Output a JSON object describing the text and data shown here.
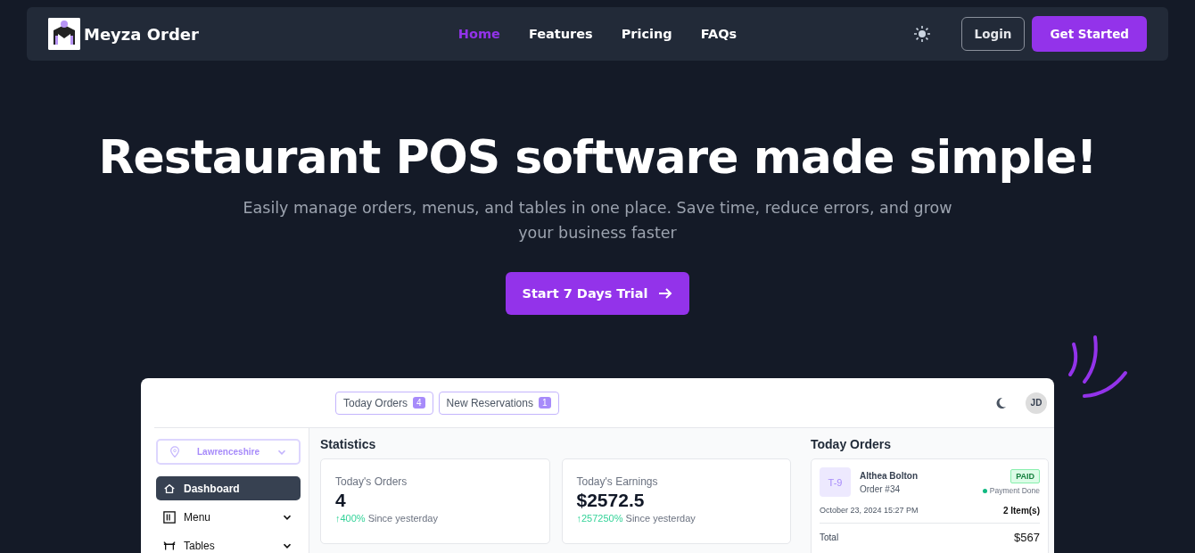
{
  "navbar": {
    "brand": "Meyza Order",
    "links": [
      {
        "label": "Home",
        "selected": true
      },
      {
        "label": "Features",
        "selected": false
      },
      {
        "label": "Pricing",
        "selected": false
      },
      {
        "label": "FAQs",
        "selected": false
      }
    ],
    "login": "Login",
    "cta": "Get Started"
  },
  "hero": {
    "title": "Restaurant POS software made simple!",
    "subtitle": "Easily manage orders, menus, and tables in one place. Save time, reduce errors, and grow your business faster",
    "button": "Start 7 Days Trial"
  },
  "preview": {
    "top_chips": [
      {
        "label": "Today Orders",
        "count": "4"
      },
      {
        "label": "New Reservations",
        "count": "1"
      }
    ],
    "avatar": "JD",
    "location": "Lawrenceshire",
    "sidebar": [
      {
        "label": "Dashboard",
        "kind": "home",
        "selected": true
      },
      {
        "label": "Menu",
        "kind": "menu",
        "selected": false
      },
      {
        "label": "Tables",
        "kind": "tables",
        "selected": false
      }
    ],
    "statistics_title": "Statistics",
    "stats": [
      {
        "label": "Today's Orders",
        "value": "4",
        "change": "↑400%",
        "note": "Since yesterday"
      },
      {
        "label": "Today's Earnings",
        "value": "$2572.5",
        "change": "↑257250%",
        "note": "Since yesterday"
      }
    ],
    "orders_title": "Today Orders",
    "order": {
      "table": "T-9",
      "customer": "Althea Bolton",
      "number": "Order #34",
      "status": "PAID",
      "payment": "Payment Done",
      "date": "October 23, 2024 15:27 PM",
      "items": "2 Item(s)",
      "total_label": "Total",
      "total": "$567"
    }
  }
}
